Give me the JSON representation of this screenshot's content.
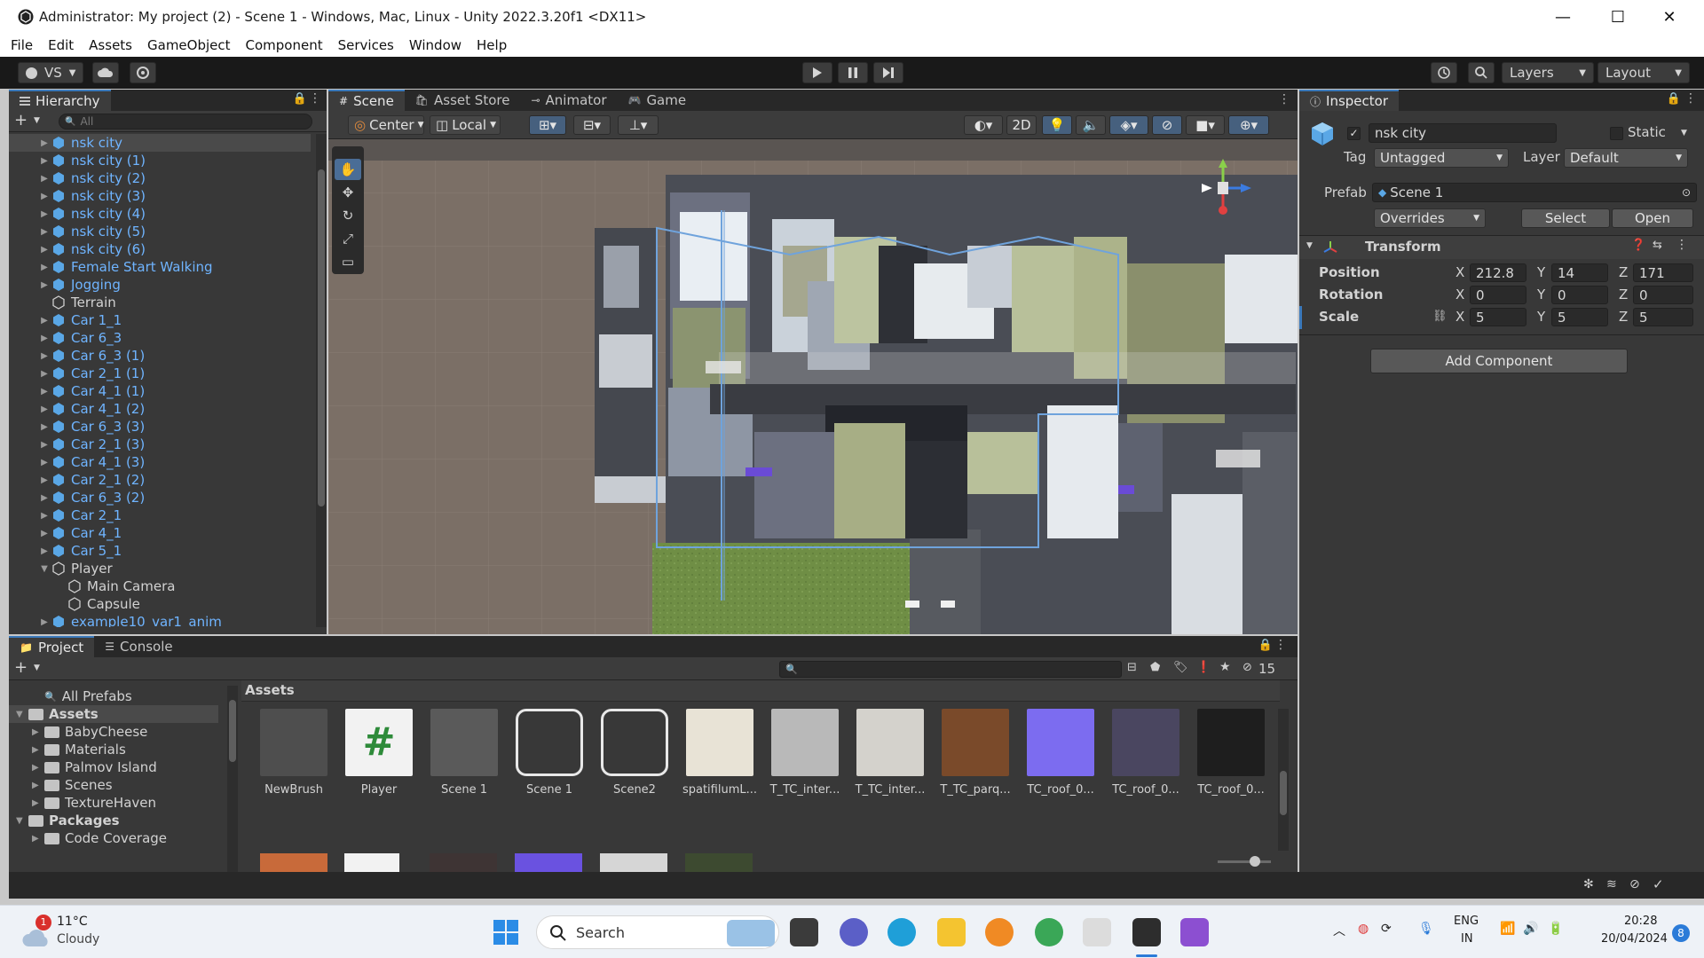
{
  "window": {
    "title": "Administrator: My project (2) - Scene 1 - Windows, Mac, Linux - Unity 2022.3.20f1 <DX11>",
    "minimize": "—",
    "maximize": "☐",
    "close": "✕"
  },
  "menu": [
    "File",
    "Edit",
    "Assets",
    "GameObject",
    "Component",
    "Services",
    "Window",
    "Help"
  ],
  "toolbar": {
    "account_label": "VS",
    "layers_label": "Layers",
    "layout_label": "Layout"
  },
  "hierarchy": {
    "tab": "Hierarchy",
    "search_placeholder": "All",
    "items": [
      {
        "label": "nsk city",
        "color": "prefab",
        "indent": 1,
        "arrow": true,
        "selected": true
      },
      {
        "label": "nsk city (1)",
        "color": "prefab",
        "indent": 1,
        "arrow": true
      },
      {
        "label": "nsk city (2)",
        "color": "prefab",
        "indent": 1,
        "arrow": true
      },
      {
        "label": "nsk city (3)",
        "color": "prefab",
        "indent": 1,
        "arrow": true
      },
      {
        "label": "nsk city (4)",
        "color": "prefab",
        "indent": 1,
        "arrow": true
      },
      {
        "label": "nsk city (5)",
        "color": "prefab",
        "indent": 1,
        "arrow": true
      },
      {
        "label": "nsk city (6)",
        "color": "prefab",
        "indent": 1,
        "arrow": true
      },
      {
        "label": "Female Start Walking",
        "color": "prefab",
        "indent": 1,
        "arrow": true
      },
      {
        "label": "Jogging",
        "color": "prefab",
        "indent": 1,
        "arrow": true
      },
      {
        "label": "Terrain",
        "color": "white",
        "indent": 1,
        "arrow": false
      },
      {
        "label": "Car 1_1",
        "color": "prefab",
        "indent": 1,
        "arrow": true
      },
      {
        "label": "Car 6_3",
        "color": "prefab",
        "indent": 1,
        "arrow": true
      },
      {
        "label": "Car 6_3 (1)",
        "color": "prefab",
        "indent": 1,
        "arrow": true
      },
      {
        "label": "Car 2_1 (1)",
        "color": "prefab",
        "indent": 1,
        "arrow": true
      },
      {
        "label": "Car 4_1 (1)",
        "color": "prefab",
        "indent": 1,
        "arrow": true
      },
      {
        "label": "Car 4_1 (2)",
        "color": "prefab",
        "indent": 1,
        "arrow": true
      },
      {
        "label": "Car 6_3 (3)",
        "color": "prefab",
        "indent": 1,
        "arrow": true
      },
      {
        "label": "Car 2_1 (3)",
        "color": "prefab",
        "indent": 1,
        "arrow": true
      },
      {
        "label": "Car 4_1 (3)",
        "color": "prefab",
        "indent": 1,
        "arrow": true
      },
      {
        "label": "Car 2_1 (2)",
        "color": "prefab",
        "indent": 1,
        "arrow": true
      },
      {
        "label": "Car 6_3 (2)",
        "color": "prefab",
        "indent": 1,
        "arrow": true
      },
      {
        "label": "Car 2_1",
        "color": "prefab",
        "indent": 1,
        "arrow": true
      },
      {
        "label": "Car 4_1",
        "color": "prefab",
        "indent": 1,
        "arrow": true
      },
      {
        "label": "Car 5_1",
        "color": "prefab",
        "indent": 1,
        "arrow": true
      },
      {
        "label": "Player",
        "color": "white",
        "indent": 1,
        "arrow": true,
        "expanded": true
      },
      {
        "label": "Main Camera",
        "color": "white",
        "indent": 2,
        "arrow": false
      },
      {
        "label": "Capsule",
        "color": "white",
        "indent": 2,
        "arrow": false
      },
      {
        "label": "example10_var1_anim",
        "color": "prefab",
        "indent": 1,
        "arrow": true
      }
    ]
  },
  "scene_tabs": [
    "Scene",
    "Asset Store",
    "Animator",
    "Game"
  ],
  "scene_toolbar": {
    "pivot": "Center",
    "space": "Local",
    "mode_2d": "2D"
  },
  "inspector": {
    "tab": "Inspector",
    "object_name": "nsk city",
    "static_label": "Static",
    "tag_label": "Tag",
    "tag_value": "Untagged",
    "layer_label": "Layer",
    "layer_value": "Default",
    "prefab_label": "Prefab",
    "prefab_value": "Scene 1",
    "overrides": "Overrides",
    "select": "Select",
    "open": "Open",
    "transform_title": "Transform",
    "position_label": "Position",
    "rotation_label": "Rotation",
    "scale_label": "Scale",
    "position": {
      "x": "212.8",
      "y": "14",
      "z": "171"
    },
    "rotation": {
      "x": "0",
      "y": "0",
      "z": "0"
    },
    "scale": {
      "x": "5",
      "y": "5",
      "z": "5"
    },
    "axis_x": "X",
    "axis_y": "Y",
    "axis_z": "Z",
    "add_component": "Add Component"
  },
  "project": {
    "tabs": [
      "Project",
      "Console"
    ],
    "tree": [
      {
        "label": "All Prefabs",
        "kind": "search",
        "indent": 1
      },
      {
        "label": "Assets",
        "kind": "folder",
        "indent": 0,
        "bold": true
      },
      {
        "label": "BabyCheese",
        "kind": "folder",
        "indent": 1
      },
      {
        "label": "Materials",
        "kind": "folder",
        "indent": 1
      },
      {
        "label": "Palmov Island",
        "kind": "folder",
        "indent": 1
      },
      {
        "label": "Scenes",
        "kind": "folder",
        "indent": 1
      },
      {
        "label": "TextureHaven",
        "kind": "folder",
        "indent": 1
      },
      {
        "label": "Packages",
        "kind": "folder",
        "indent": 0,
        "bold": true
      },
      {
        "label": "Code Coverage",
        "kind": "folder",
        "indent": 1
      }
    ],
    "breadcrumb": "Assets",
    "hidden_count": "15",
    "assets": [
      {
        "label": "NewBrush",
        "color": "#4e4e4e"
      },
      {
        "label": "Player",
        "color": "#f2f2f2"
      },
      {
        "label": "Scene 1",
        "color": "#5a5a5a"
      },
      {
        "label": "Scene 1",
        "color": "#383838"
      },
      {
        "label": "Scene2",
        "color": "#383838"
      },
      {
        "label": "spatifilumL...",
        "color": "#e8e3d6"
      },
      {
        "label": "T_TC_inter...",
        "color": "#b9b9b9"
      },
      {
        "label": "T_TC_inter...",
        "color": "#d4d2cc"
      },
      {
        "label": "T_TC_parq...",
        "color": "#7a4a2a"
      },
      {
        "label": "TC_roof_0...",
        "color": "#7c6cf0"
      },
      {
        "label": "TC_roof_0...",
        "color": "#4a4660"
      },
      {
        "label": "TC_roof_0...",
        "color": "#1e1e1e"
      }
    ]
  },
  "taskbar": {
    "weather_temp": "11°C",
    "weather_desc": "Cloudy",
    "weather_badge": "1",
    "search": "Search",
    "lang_top": "ENG",
    "lang_bottom": "IN",
    "time": "20:28",
    "date": "20/04/2024",
    "notif_count": "8"
  }
}
